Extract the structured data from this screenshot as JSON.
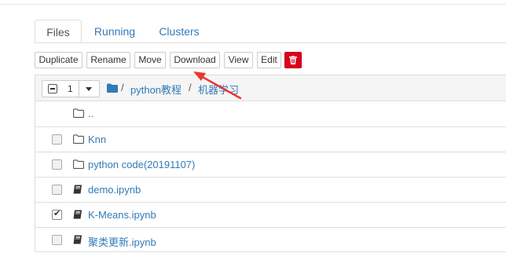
{
  "tabs": [
    {
      "label": "Files",
      "active": true
    },
    {
      "label": "Running",
      "active": false
    },
    {
      "label": "Clusters",
      "active": false
    }
  ],
  "toolbar": {
    "duplicate": "Duplicate",
    "rename": "Rename",
    "move": "Move",
    "download": "Download",
    "view": "View",
    "edit": "Edit",
    "delete_icon": "trash-icon"
  },
  "selection": {
    "count": "1"
  },
  "breadcrumb": {
    "root_icon": "folder-icon",
    "sep1": "/",
    "item1": "python教程",
    "sep2": "/",
    "item2": "机器学习"
  },
  "rows": [
    {
      "name": "..",
      "type": "folder",
      "checkbox": false,
      "checked": false
    },
    {
      "name": "Knn",
      "type": "folder",
      "checkbox": true,
      "checked": false
    },
    {
      "name": "python code(20191107)",
      "type": "folder",
      "checkbox": true,
      "checked": false
    },
    {
      "name": "demo.ipynb",
      "type": "notebook",
      "checkbox": true,
      "checked": false
    },
    {
      "name": "K-Means.ipynb",
      "type": "notebook",
      "checkbox": true,
      "checked": true
    },
    {
      "name": "聚类更新.ipynb",
      "type": "notebook",
      "checkbox": true,
      "checked": false
    }
  ],
  "colors": {
    "link": "#337ab7",
    "danger": "#d9001b",
    "annotation_arrow": "#e8372f"
  }
}
